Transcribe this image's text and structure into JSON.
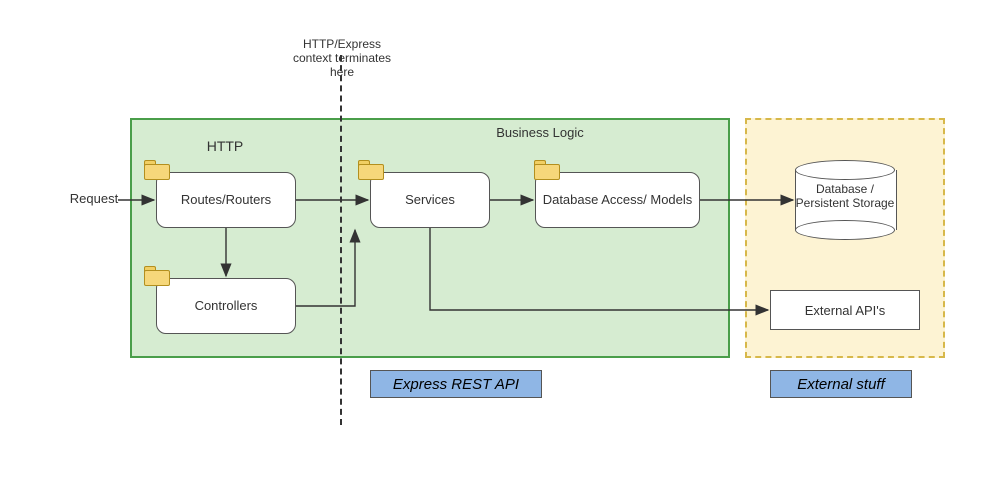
{
  "divider_note": "HTTP/Express context terminates here",
  "section_labels": {
    "http": "HTTP",
    "business_logic": "Business Logic"
  },
  "request_label": "Request",
  "nodes": {
    "routes": "Routes/Routers",
    "controllers": "Controllers",
    "services": "Services",
    "db_access": "Database Access/ Models",
    "database": "Database / Persistent Storage",
    "external_apis": "External API's"
  },
  "regions": {
    "api": "Express REST API",
    "external": "External stuff"
  },
  "colors": {
    "api_region_bg": "#d6ecd1",
    "api_region_border": "#4a9e4a",
    "external_region_bg": "#fdf3d3",
    "external_region_border": "#d7b84a",
    "region_label_bg": "#8fb6e5",
    "folder_fill": "#f6d77a"
  },
  "edges": [
    {
      "from": "Request",
      "to": "Routes/Routers"
    },
    {
      "from": "Routes/Routers",
      "to": "Controllers"
    },
    {
      "from": "Routes/Routers",
      "to": "Services"
    },
    {
      "from": "Controllers",
      "to": "Services"
    },
    {
      "from": "Services",
      "to": "Database Access/Models"
    },
    {
      "from": "Services",
      "to": "External API's"
    },
    {
      "from": "Database Access/Models",
      "to": "Database / Persistent Storage"
    }
  ]
}
